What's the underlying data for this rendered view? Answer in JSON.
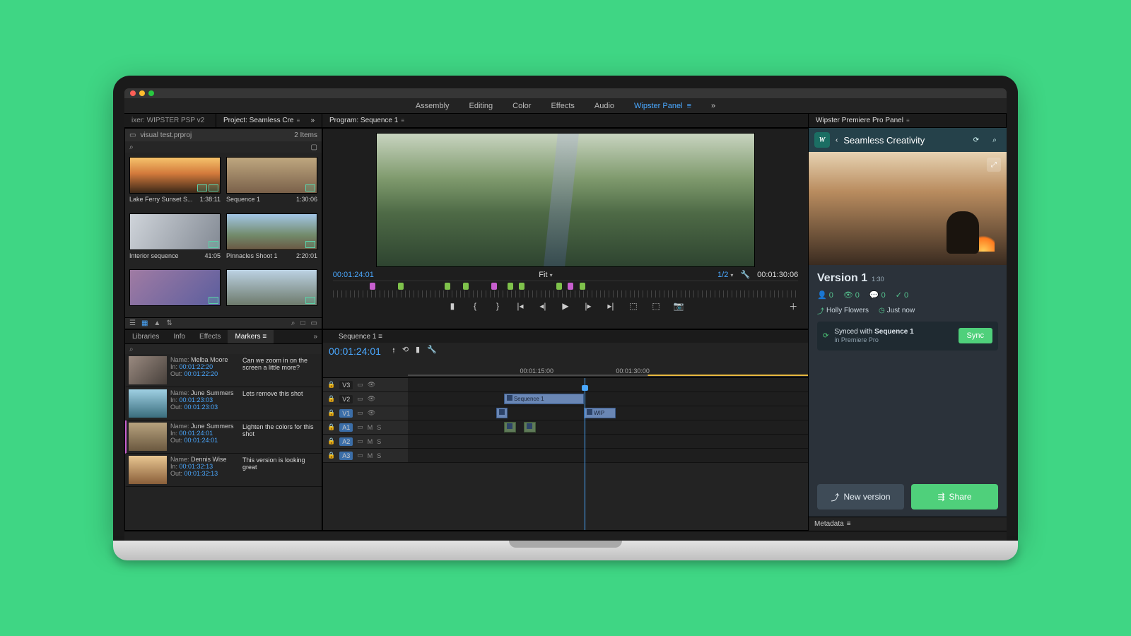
{
  "topmenu": {
    "items": [
      "Assembly",
      "Editing",
      "Color",
      "Effects",
      "Audio",
      "Wipster Panel"
    ],
    "active_index": 5
  },
  "workspace": {
    "left_tab": "ixer: WIPSTER PSP v2",
    "project_tab": "Project: Seamless Cre",
    "program_tab": "Program: Sequence 1"
  },
  "project": {
    "bin_name": "visual test.prproj",
    "item_count": "2 Items",
    "clips": [
      {
        "name": "Lake Ferry Sunset S...",
        "dur": "1:38:11",
        "thumb": "sunset",
        "double_badge": true
      },
      {
        "name": "Sequence 1",
        "dur": "1:30:06",
        "thumb": "silhouette"
      },
      {
        "name": "Interior sequence",
        "dur": "41:05",
        "thumb": "interior"
      },
      {
        "name": "Pinnacles Shoot 1",
        "dur": "2:20:01",
        "thumb": "cliff"
      },
      {
        "name": "",
        "dur": "",
        "thumb": "people"
      },
      {
        "name": "",
        "dur": "",
        "thumb": "mount"
      }
    ]
  },
  "program": {
    "in_tc": "00:01:24:01",
    "out_tc": "00:01:30:06",
    "fit_label": "Fit",
    "zoom_label": "1/2",
    "markers": [
      {
        "pos": 8,
        "c": "p"
      },
      {
        "pos": 14,
        "c": "g"
      },
      {
        "pos": 24,
        "c": "g"
      },
      {
        "pos": 28,
        "c": "g"
      },
      {
        "pos": 34,
        "c": "p"
      },
      {
        "pos": 37.5,
        "c": "g"
      },
      {
        "pos": 40,
        "c": "g"
      },
      {
        "pos": 48,
        "c": "g"
      },
      {
        "pos": 50.5,
        "c": "p"
      },
      {
        "pos": 53,
        "c": "g"
      }
    ]
  },
  "lower_tabs": {
    "items": [
      "Libraries",
      "Info",
      "Effects",
      "Markers"
    ],
    "active_index": 3
  },
  "markers": [
    {
      "name": "Melba Moore",
      "in": "00:01:22:20",
      "out": "00:01:22:20",
      "comment": "Can we zoom in on the screen a little more?",
      "thumb": "t1"
    },
    {
      "name": "June Summers",
      "in": "00:01:23:03",
      "out": "00:01:23:03",
      "comment": "Lets remove this shot",
      "thumb": "t2"
    },
    {
      "name": "June Summers",
      "in": "00:01:24:01",
      "out": "00:01:24:01",
      "comment": "Lighten the colors for this shot",
      "thumb": "t3"
    },
    {
      "name": "Dennis Wise",
      "in": "00:01:32:13",
      "out": "00:01:32:13",
      "comment": "This version is looking great",
      "thumb": "t4"
    }
  ],
  "timeline": {
    "tab": "Sequence 1",
    "tc": "00:01:24:01",
    "ruler": [
      {
        "pos": 28,
        "label": "00:01:15:00"
      },
      {
        "pos": 52,
        "label": "00:01:30:00"
      }
    ],
    "top_markers": [
      {
        "pos": 24,
        "c": "g"
      },
      {
        "pos": 29,
        "c": "g"
      },
      {
        "pos": 40,
        "c": "p"
      },
      {
        "pos": 44,
        "c": "g"
      },
      {
        "pos": 50,
        "c": "g"
      }
    ],
    "tracks": [
      {
        "id": "V3",
        "type": "v"
      },
      {
        "id": "V2",
        "type": "v",
        "clips": [
          {
            "l": 24,
            "w": 20,
            "label": "Sequence 1"
          }
        ]
      },
      {
        "id": "V1",
        "type": "v",
        "sel": true,
        "clips": [
          {
            "l": 22,
            "w": 3
          },
          {
            "l": 44,
            "w": 8,
            "label": "WIP"
          }
        ]
      },
      {
        "id": "A1",
        "type": "a",
        "sel": true,
        "clips": [
          {
            "l": 24,
            "w": 3
          },
          {
            "l": 29,
            "w": 3
          }
        ]
      },
      {
        "id": "A2",
        "type": "a",
        "sel": true
      },
      {
        "id": "A3",
        "type": "a",
        "sel": true
      }
    ]
  },
  "wipster": {
    "panel_title": "Wipster Premiere Pro Panel",
    "logo": "W",
    "title": "Seamless Creativity",
    "version_label": "Version 1",
    "version_dur": "1:30",
    "stats": {
      "people": "0",
      "views": "0",
      "comments": "0",
      "checks": "0"
    },
    "uploader": "Holly Flowers",
    "when": "Just now",
    "sync_line": "Synced with",
    "sync_target": "Sequence 1",
    "sync_sub": "in Premiere Pro",
    "sync_button": "Sync",
    "new_version": "New version",
    "share": "Share",
    "metadata_label": "Metadata"
  },
  "labels": {
    "name": "Name:",
    "in": "In:",
    "out": "Out:"
  }
}
